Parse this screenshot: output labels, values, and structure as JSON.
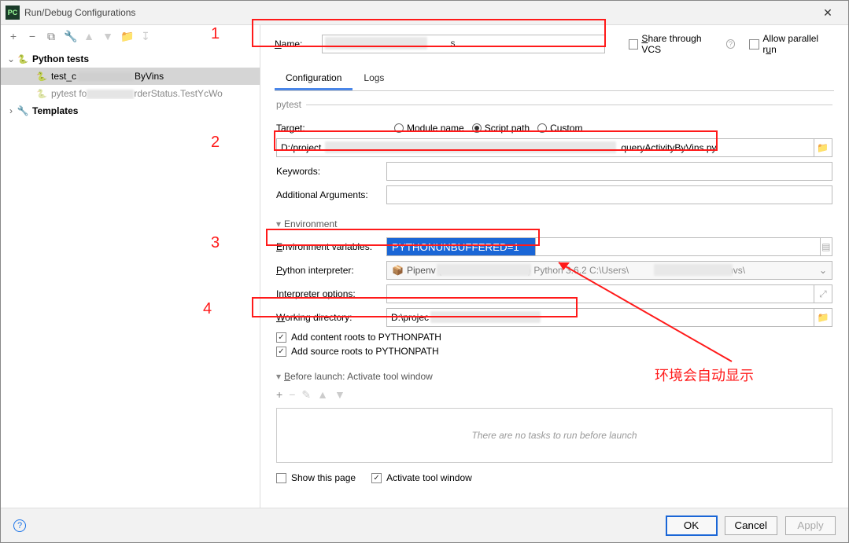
{
  "window": {
    "title": "Run/Debug Configurations"
  },
  "toolbar": {
    "add": "+",
    "remove": "−",
    "copy": "⧉",
    "wrench": "🔧",
    "up": "▲",
    "down": "▼",
    "folder": "📂",
    "sort": "↧"
  },
  "tree": {
    "root": "Python tests",
    "item0": "test_c",
    "item0_suffix": "ByVins",
    "item1_prefix": "pytest fo",
    "item1_suffix": "rderStatus.TestYcWo",
    "templates": "Templates"
  },
  "header": {
    "name_label": "Name:",
    "name_value": "",
    "name_suffix": "s",
    "share_label": "Share through VCS",
    "parallel_label": "Allow parallel run"
  },
  "tabs": {
    "config": "Configuration",
    "logs": "Logs"
  },
  "pytest": {
    "legend": "pytest",
    "target_label": "Target:",
    "r_module": "Module name",
    "r_script": "Script path",
    "r_custom": "Custom",
    "path_prefix": "D:/project",
    "path_suffix": ".queryActivityByVins.py",
    "keywords": "Keywords:",
    "addl": "Additional Arguments:"
  },
  "env": {
    "section": "Environment",
    "envvar_label": "Environment variables:",
    "envvar_value": "PYTHONUNBUFFERED=1",
    "interp_label": "Python interpreter:",
    "interp_prefix": "Pipenv (",
    "interp_mid": ") Python 3.6.2 C:\\Users\\",
    "interp_suffix": "tualenvs\\",
    "opts_label": "Interpreter options:",
    "workdir_label": "Working directory:",
    "workdir_value": "D:\\projec",
    "addcontent": "Add content roots to PYTHONPATH",
    "addsource": "Add source roots to PYTHONPATH"
  },
  "before": {
    "section": "Before launch: Activate tool window",
    "empty": "There are no tasks to run before launch",
    "showpage": "Show this page",
    "activate": "Activate tool window"
  },
  "buttons": {
    "ok": "OK",
    "cancel": "Cancel",
    "apply": "Apply"
  },
  "annotations": {
    "n1": "1",
    "n2": "2",
    "n3": "3",
    "n4": "4",
    "note": "环境会自动显示"
  }
}
